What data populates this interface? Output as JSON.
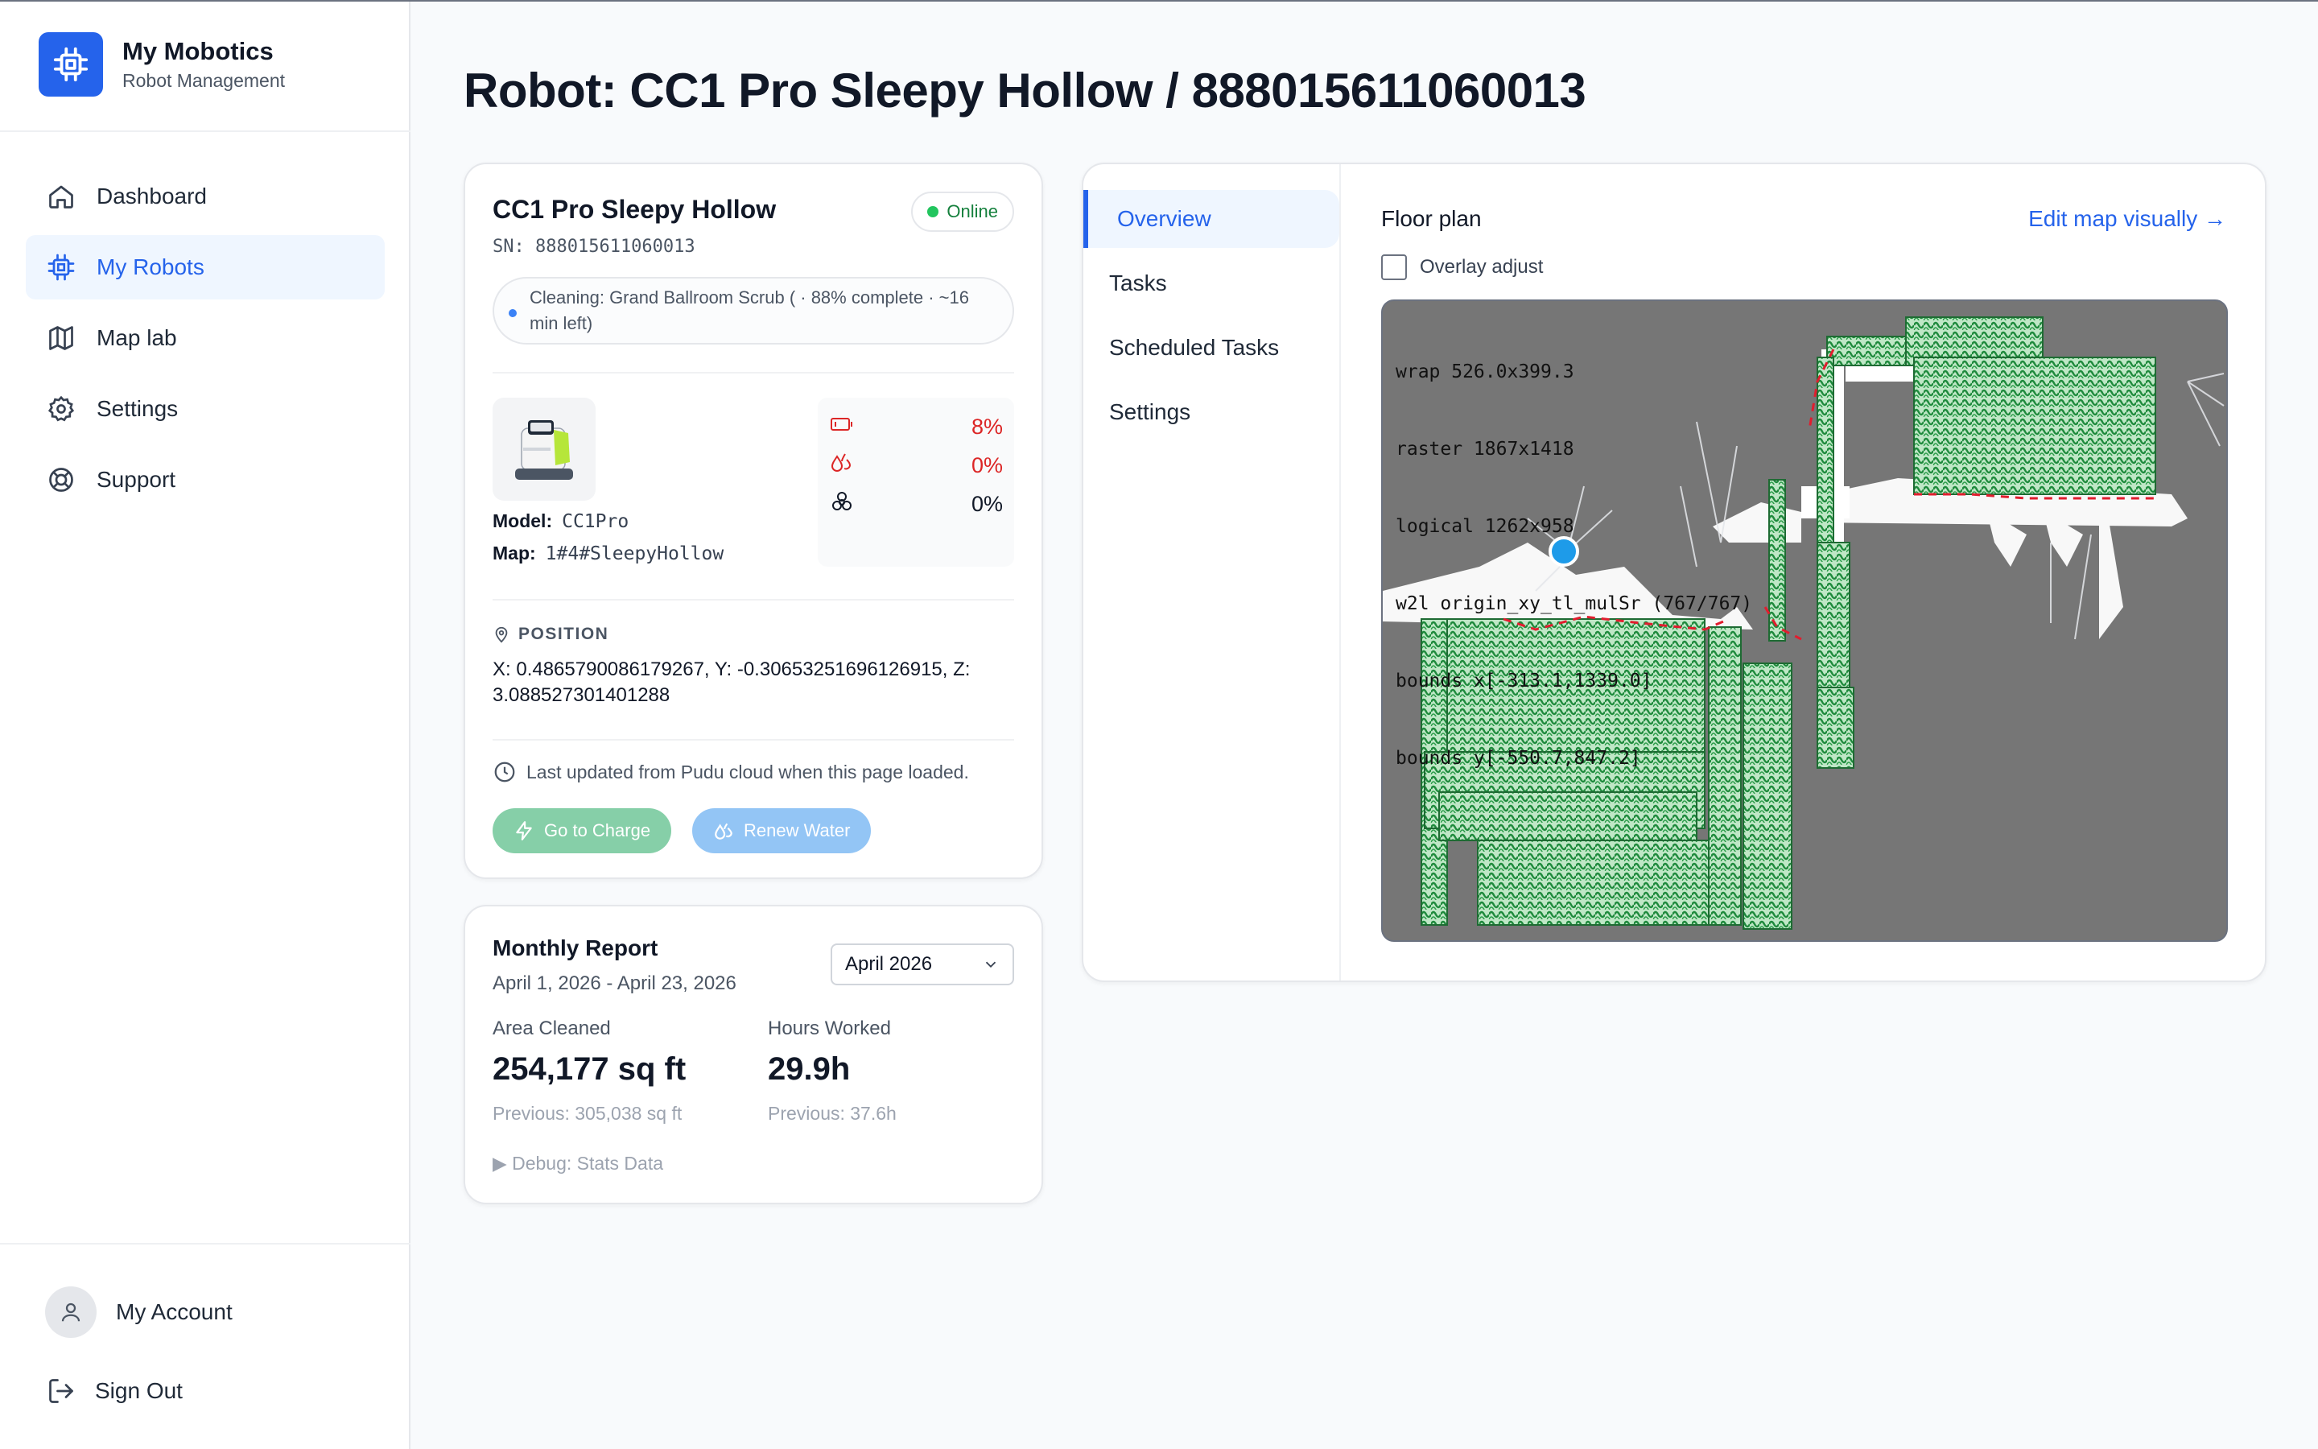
{
  "brand": {
    "title": "My Mobotics",
    "subtitle": "Robot Management",
    "logo_icon": "chip-icon",
    "accent": "#2563eb"
  },
  "nav": [
    {
      "label": "Dashboard",
      "icon": "home-icon",
      "active": false
    },
    {
      "label": "My Robots",
      "icon": "chip-icon",
      "active": true
    },
    {
      "label": "Map lab",
      "icon": "map-icon",
      "active": false
    },
    {
      "label": "Settings",
      "icon": "gear-icon",
      "active": false
    },
    {
      "label": "Support",
      "icon": "lifebuoy-icon",
      "active": false
    }
  ],
  "account": {
    "label": "My Account",
    "icon": "user-icon"
  },
  "signout": {
    "label": "Sign Out",
    "icon": "logout-icon"
  },
  "page": {
    "title": "Robot: CC1 Pro Sleepy Hollow / 888015611060013"
  },
  "robot": {
    "name": "CC1 Pro Sleepy Hollow",
    "sn": "SN: 888015611060013",
    "status": "Online",
    "status_color": "#22c55e",
    "activity": "Cleaning: Grand Ballroom Scrub ( · 88% complete · ~16 min left)",
    "model_label": "Model:",
    "model": "CC1Pro",
    "map_label": "Map:",
    "map": "1#4#SleepyHollow",
    "levels": [
      {
        "icon": "battery-icon",
        "value": "8%",
        "color": "#dc2626"
      },
      {
        "icon": "water-drop-icon",
        "value": "0%",
        "color": "#dc2626"
      },
      {
        "icon": "biohazard-icon",
        "value": "0%",
        "color": "#111827"
      }
    ],
    "position_label": "POSITION",
    "position": "X: 0.4865790086179267, Y: -0.30653251696126915, Z: 3.088527301401288",
    "updated": "Last updated from Pudu cloud when this page loaded.",
    "buttons": {
      "charge": "Go to Charge",
      "water": "Renew Water"
    }
  },
  "report": {
    "title": "Monthly Report",
    "range": "April 1, 2026 - April 23, 2026",
    "month": "April 2026",
    "area_label": "Area Cleaned",
    "area_value": "254,177 sq ft",
    "area_prev": "Previous: 305,038 sq ft",
    "hours_label": "Hours Worked",
    "hours_value": "29.9h",
    "hours_prev": "Previous: 37.6h",
    "debug": "▶ Debug: Stats Data"
  },
  "tabs": [
    {
      "label": "Overview",
      "active": true
    },
    {
      "label": "Tasks",
      "active": false
    },
    {
      "label": "Scheduled Tasks",
      "active": false
    },
    {
      "label": "Settings",
      "active": false
    }
  ],
  "floorplan": {
    "title": "Floor plan",
    "edit_link": "Edit map visually →",
    "overlay_label": "Overlay adjust",
    "overlay_checked": false,
    "debug_lines": [
      "wrap 526.0x399.3",
      "raster 1867x1418",
      "logical 1262x958",
      "w2l origin_xy_tl_mulSr (767/767)",
      "bounds x[-313.1,1339.0]",
      "bounds y[-550.7,847.2]"
    ],
    "robot_marker_color": "#1e9be9",
    "cleaned_color": "#1e8a3c"
  }
}
